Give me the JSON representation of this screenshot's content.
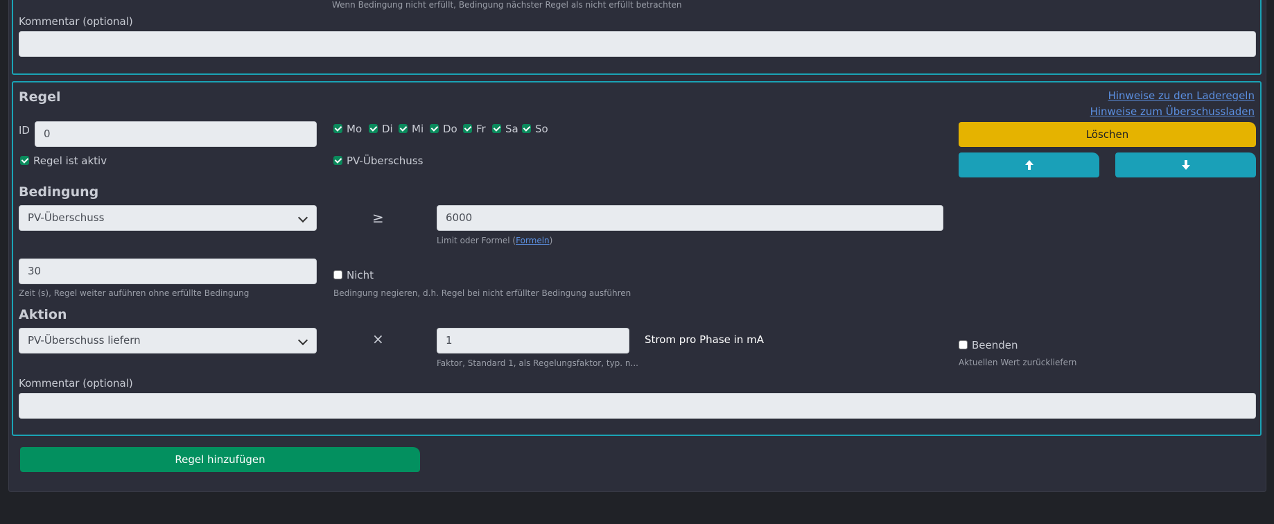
{
  "top_section": {
    "cut_hint": "Wenn Bedingung nicht erfüllt, Bedingung nächster Regel als nicht erfüllt betrachten",
    "comment_label": "Kommentar (optional)",
    "comment_value": ""
  },
  "rule": {
    "title": "Regel",
    "links": [
      "Hinweise zu den Laderegeln",
      "Hinweise zum Überschussladen"
    ],
    "id_label": "ID",
    "id_value": "0",
    "days": [
      {
        "label": "Mo",
        "checked": true
      },
      {
        "label": "Di",
        "checked": true
      },
      {
        "label": "Mi",
        "checked": true
      },
      {
        "label": "Do",
        "checked": true
      },
      {
        "label": "Fr",
        "checked": true
      },
      {
        "label": "Sa",
        "checked": true
      },
      {
        "label": "So",
        "checked": true
      }
    ],
    "active_label": "Regel ist aktiv",
    "pv_label": "PV-Überschuss",
    "delete_label": "Löschen",
    "up_icon": "arrow-up-icon",
    "down_icon": "arrow-down-icon"
  },
  "condition": {
    "title": "Bedingung",
    "select_value": "PV-Überschuss",
    "operator": "≥",
    "limit_value": "6000",
    "limit_hint_prefix": "Limit oder Formel (",
    "limit_hint_link": "Formeln",
    "limit_hint_suffix": ")",
    "time_value": "30",
    "time_hint": "Zeit (s), Regel weiter auführen ohne erfüllte Bedingung",
    "negate_label": "Nicht",
    "negate_hint": "Bedingung negieren, d.h. Regel bei nicht erfüllter Bedingung ausführen"
  },
  "action": {
    "title": "Aktion",
    "select_value": "PV-Überschuss liefern",
    "operator": "×",
    "factor_value": "1",
    "unit_label": "Strom pro Phase in mA",
    "factor_hint": "Faktor, Standard 1, als Regelungsfaktor, typ. n...",
    "end_label": "Beenden",
    "end_hint": "Aktuellen Wert zurückliefern",
    "comment_label": "Kommentar (optional)",
    "comment_value": ""
  },
  "footer": {
    "add_rule_label": "Regel hinzufügen"
  },
  "colors": {
    "accent_border": "#1aa3b5",
    "delete_button": "#e5b300",
    "arrow_buttons": "#1aa0b8",
    "add_button": "#03905f",
    "checkbox": "#0b8a5c"
  }
}
